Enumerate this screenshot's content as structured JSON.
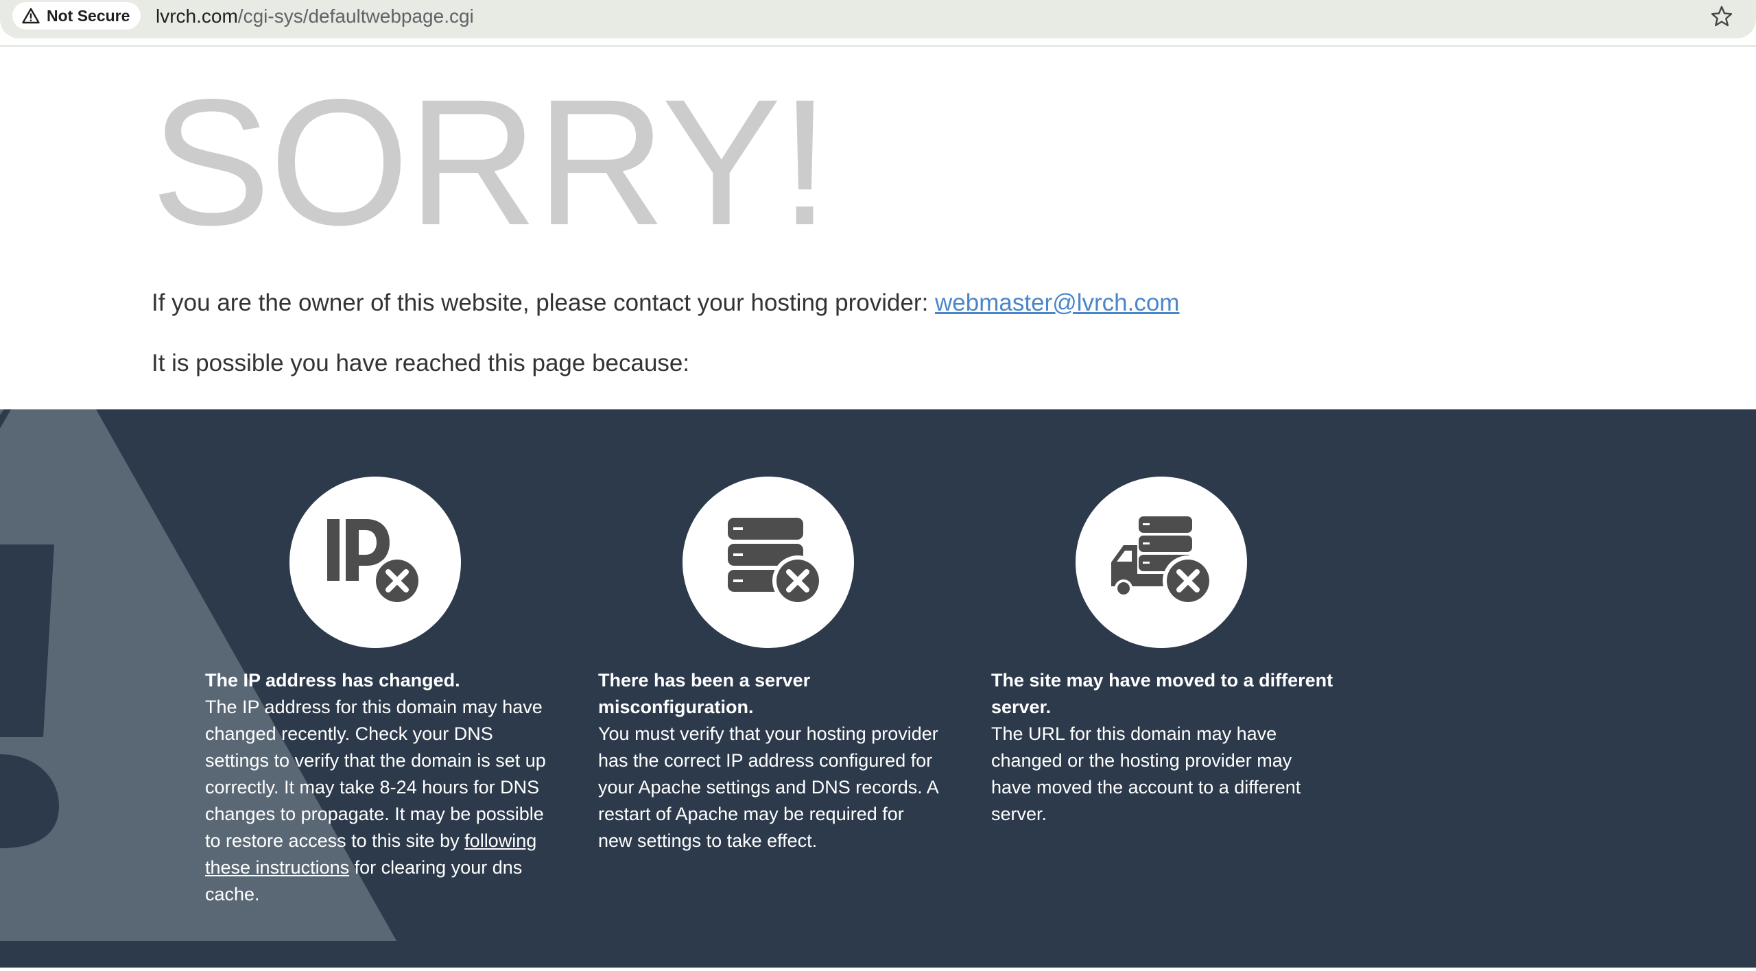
{
  "browser": {
    "security_label": "Not Secure",
    "url_domain": "lvrch.com",
    "url_path": "/cgi-sys/defaultwebpage.cgi",
    "icons": [
      "warning-triangle-icon",
      "bookmark-star-icon"
    ]
  },
  "page": {
    "heading": "SORRY!",
    "owner_text": "If you are the owner of this website, please contact your hosting provider: ",
    "owner_email": "webmaster@lvrch.com",
    "reason_intro": "It is possible you have reached this page because:"
  },
  "reasons": [
    {
      "icon": "ip-error-icon",
      "title": "The IP address has changed.",
      "body": "The IP address for this domain may have changed recently. Check your DNS settings to verify that the domain is set up correctly. It may take 8-24 hours for DNS changes to propagate. It may be possible to restore access to this site by ",
      "link": "following these instructions",
      "body_after": " for clearing your dns cache."
    },
    {
      "icon": "server-error-icon",
      "title": "There has been a server misconfiguration.",
      "body": "You must verify that your hosting provider has the correct IP address configured for your Apache settings and DNS records. A restart of Apache may be required for new settings to take effect."
    },
    {
      "icon": "server-moved-icon",
      "title": "The site may have moved to a different server.",
      "body": "The URL for this domain may have changed or the hosting provider may have moved the account to a different server."
    }
  ],
  "colors": {
    "heading": "#cccccc",
    "link": "#4a86c8",
    "dark_background": "#2c3a4b",
    "icon": "#4d4d4d"
  }
}
